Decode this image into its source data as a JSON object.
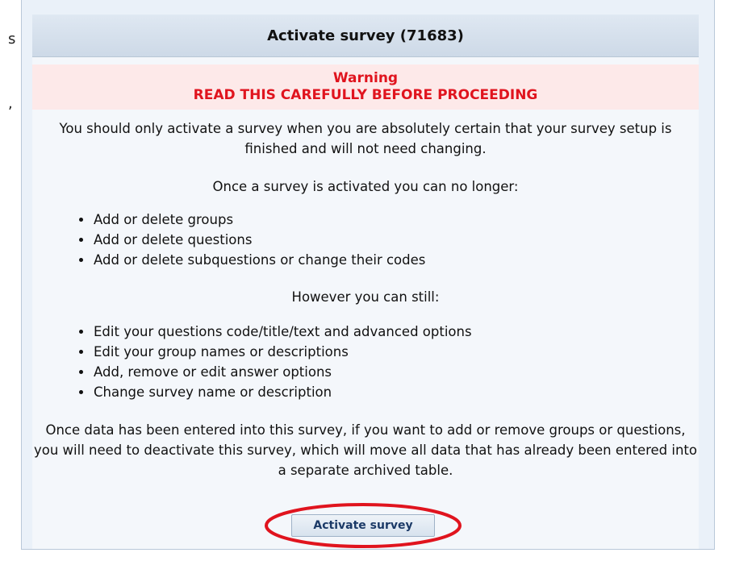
{
  "left_partial_text": {
    "line1": "s",
    "line2": ","
  },
  "panel": {
    "title": "Activate survey (71683)"
  },
  "warning": {
    "heading": "Warning",
    "subheading": "READ THIS CAREFULLY BEFORE PROCEEDING"
  },
  "content": {
    "intro": "You should only activate a survey when you are absolutely certain that your survey setup is finished and will not need changing.",
    "no_longer_heading": "Once a survey is activated you can no longer:",
    "no_longer_items": [
      "Add or delete groups",
      "Add or delete questions",
      "Add or delete subquestions or change their codes"
    ],
    "still_heading": "However you can still:",
    "still_items": [
      "Edit your questions code/title/text and advanced options",
      "Edit your group names or descriptions",
      "Add, remove or edit answer options",
      "Change survey name or description"
    ],
    "closing": "Once data has been entered into this survey, if you want to add or remove groups or questions, you will need to deactivate this survey, which will move all data that has already been entered into a separate archived table."
  },
  "actions": {
    "activate_label": "Activate survey"
  },
  "colors": {
    "warning_text": "#e0141e",
    "warning_bg": "#fde9e9",
    "highlight_ring": "#e0141e",
    "button_text": "#1b3a67"
  }
}
